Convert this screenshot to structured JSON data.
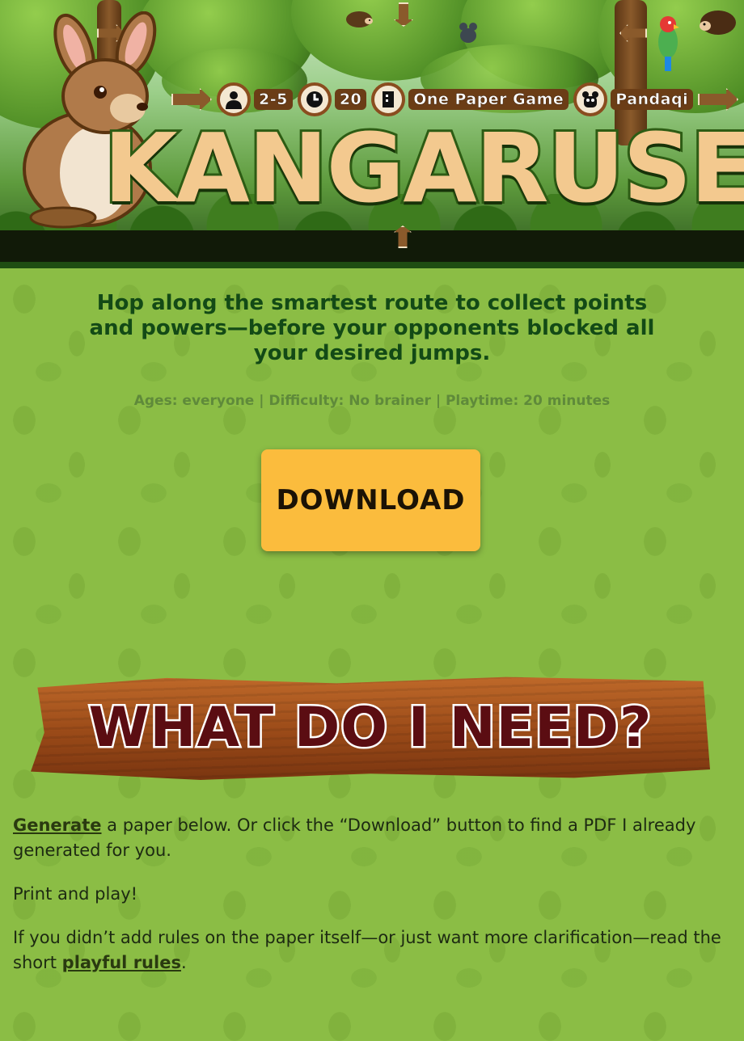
{
  "header": {
    "title": "Kangaruse",
    "badges": {
      "players": "2-5",
      "time": "20",
      "format": "One Paper Game",
      "publisher": "Pandaqi"
    }
  },
  "main": {
    "tagline": "Hop along the smartest route to collect points and powers—before your opponents blocked all your desired jumps.",
    "meta": "Ages: everyone | Difficulty: No brainer | Playtime: 20 minutes",
    "download_label": "Download",
    "section_heading": "What do I need?",
    "paragraphs": {
      "p1_link": "Generate",
      "p1_text": " a paper below. Or click the “Download” button to find a PDF I already generated for you.",
      "p2_text": "Print and play!",
      "p3_text": "If you didn’t add rules on the paper itself—or just want more clarification—read the short ",
      "p3_link": "playful rules",
      "p3_end": "."
    }
  },
  "colors": {
    "background": "#8bbd45",
    "tagline": "#134a16",
    "meta": "#5f8a3a",
    "download_button": "#fbbc3d",
    "plank_text": "#5b0d12"
  },
  "icons": [
    "kangaroo-mascot",
    "person-icon",
    "clock-icon",
    "paper-icon",
    "panda-icon",
    "arrow-sign-icon",
    "hedgehog-icon",
    "parrot-icon"
  ]
}
